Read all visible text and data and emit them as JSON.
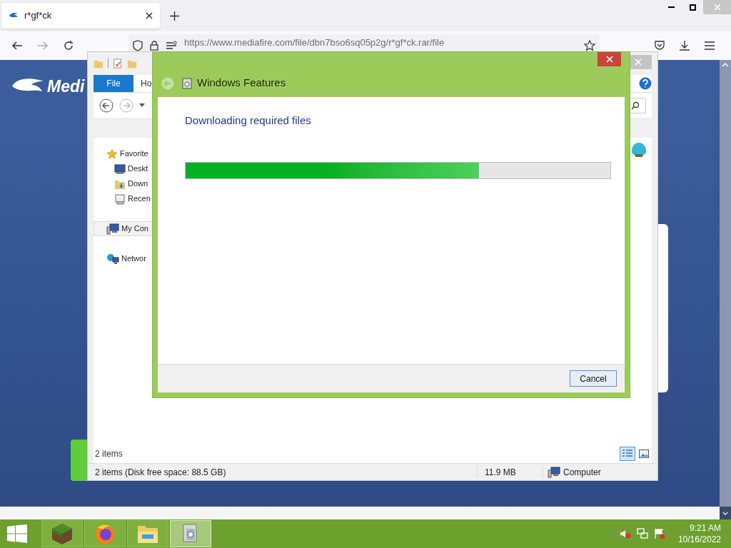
{
  "browser": {
    "tab_title": "r*gf*ck",
    "url": "https://www.mediafire.com/file/dbn7bso6sq05p2g/r*gf*ck.rar/file"
  },
  "page": {
    "logo_text": "Medi"
  },
  "explorer": {
    "ribbon_tabs": [
      {
        "label": "File",
        "selected": true
      },
      {
        "label": "Ho",
        "selected": false
      }
    ],
    "nav_items": [
      {
        "label": "Favorite",
        "kind": "favorites",
        "selected": false
      },
      {
        "label": "Deskt",
        "kind": "desktop",
        "selected": false
      },
      {
        "label": "Down",
        "kind": "downloads",
        "selected": false
      },
      {
        "label": "Recen",
        "kind": "recent",
        "selected": false
      },
      {
        "label": "My Con",
        "kind": "computer",
        "selected": true
      },
      {
        "label": "Networ",
        "kind": "network",
        "selected": false
      }
    ],
    "item_count": "2 items",
    "views": [
      {
        "kind": "details",
        "selected": true
      },
      {
        "kind": "tiles",
        "selected": false
      }
    ],
    "status": {
      "summary": "2 items (Disk free space: 88.5 GB)",
      "size": "11.9 MB",
      "location": "Computer"
    }
  },
  "dialog": {
    "title": "Windows Features",
    "heading": "Downloading required files",
    "progress": {
      "level": 0.69
    },
    "buttons": [
      "Cancel"
    ]
  },
  "taskbar": {
    "apps": [
      {
        "kind": "minecraft",
        "selected": false
      },
      {
        "kind": "firefox",
        "selected": false
      },
      {
        "kind": "explorer",
        "selected": false
      },
      {
        "kind": "features",
        "selected": true
      }
    ],
    "time": "9:21 AM",
    "date": "10/16/2022"
  }
}
